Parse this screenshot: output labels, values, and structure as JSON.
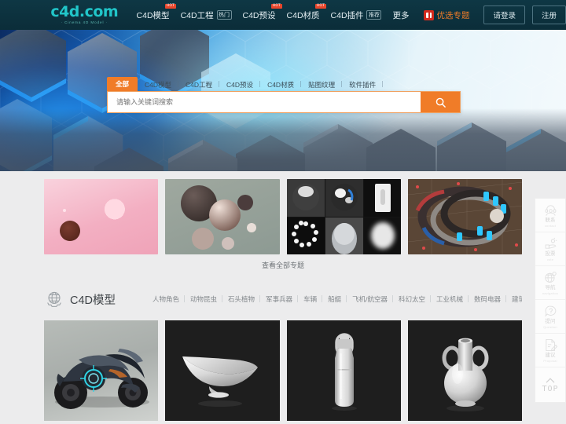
{
  "header": {
    "logo": {
      "text": "c4d.com",
      "subtitle": "· Cinema 4D Model ·"
    },
    "nav": [
      {
        "label": "C4D模型",
        "badge": "HOT",
        "tag": ""
      },
      {
        "label": "C4D工程",
        "badge": "",
        "tag": "热门"
      },
      {
        "label": "C4D预设",
        "badge": "HOT",
        "tag": ""
      },
      {
        "label": "C4D材质",
        "badge": "HOT",
        "tag": ""
      },
      {
        "label": "C4D插件",
        "badge": "",
        "tag": "推荐"
      },
      {
        "label": "更多",
        "badge": "",
        "tag": ""
      }
    ],
    "promo": {
      "label": "优选专题",
      "icon": "gift-icon",
      "color": "#f07c28"
    },
    "login_label": "请登录",
    "register_label": "注册"
  },
  "hero": {
    "search_tabs": [
      {
        "label": "全部",
        "active": true
      },
      {
        "label": "C4D模型",
        "active": false
      },
      {
        "label": "C4D工程",
        "active": false
      },
      {
        "label": "C4D预设",
        "active": false
      },
      {
        "label": "C4D材质",
        "active": false
      },
      {
        "label": "贴图纹理",
        "active": false
      },
      {
        "label": "软件插件",
        "active": false
      }
    ],
    "search_placeholder": "请输入关键词搜索",
    "search_value": "",
    "search_icon": "search-icon",
    "accent_color": "#f07c28"
  },
  "topics": {
    "cards": [
      {
        "name": "pink-candy-scene"
      },
      {
        "name": "glossy-spheres"
      },
      {
        "name": "material-previews"
      },
      {
        "name": "mechanical-rings"
      }
    ],
    "view_all_label": "查看全部专题"
  },
  "section": {
    "icon": "globe-gear-icon",
    "title": "C4D模型",
    "categories": [
      "人物角色",
      "动物昆虫",
      "石头植物",
      "军事兵器",
      "车辆",
      "船艇",
      "飞机/航空器",
      "科幻太空",
      "工业机械",
      "数码电器",
      "建筑设施",
      "..."
    ]
  },
  "models": {
    "items": [
      {
        "name": "concept-motorcycle"
      },
      {
        "name": "curved-bowl"
      },
      {
        "name": "water-bottle"
      },
      {
        "name": "ceramic-vase"
      }
    ]
  },
  "rail": {
    "items": [
      {
        "zh": "联系",
        "en": "contact",
        "icon": "headset-operator-icon"
      },
      {
        "zh": "投票",
        "en": "vote",
        "icon": "hand-vote-icon"
      },
      {
        "zh": "导航",
        "en": "navigation",
        "icon": "globe-pin-icon"
      },
      {
        "zh": "提问",
        "en": "Question",
        "icon": "question-bubble-icon"
      },
      {
        "zh": "建议",
        "en": "Proposal",
        "icon": "document-pen-icon"
      }
    ],
    "top_label": "TOP",
    "top_icon": "chevron-up-icon"
  }
}
